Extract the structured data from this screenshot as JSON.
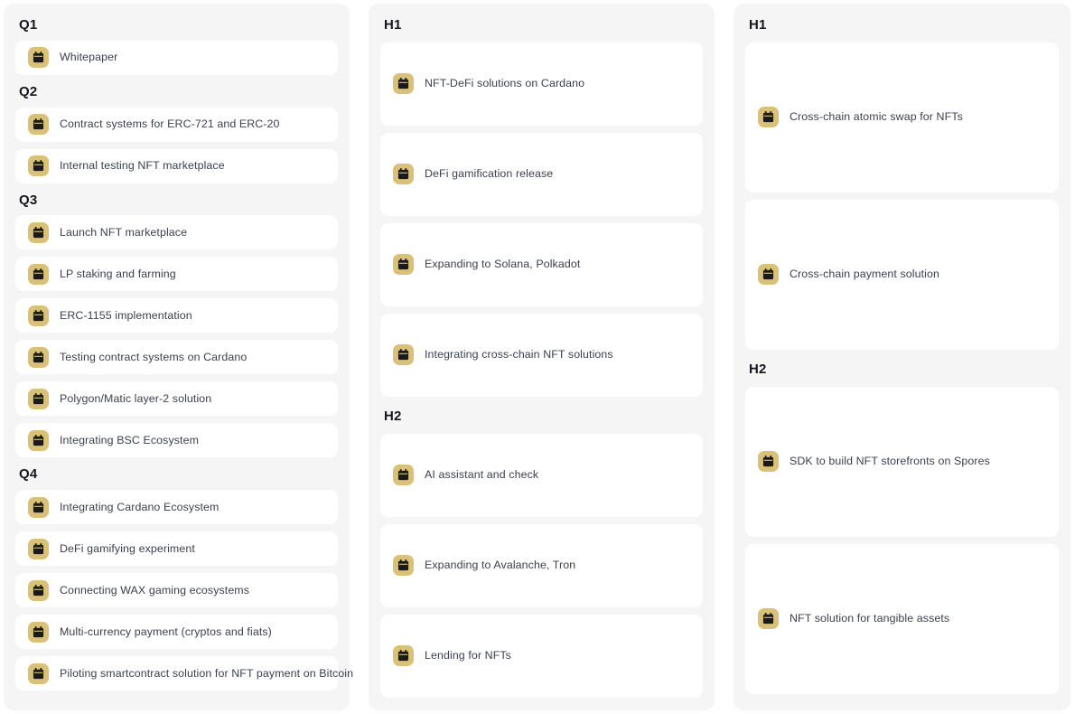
{
  "theme": {
    "page_background": "#ffffff",
    "panel_background": "#f5f5f5",
    "card_background": "#ffffff",
    "icon_badge_color": "#d9c179",
    "icon_glyph_color": "#1a1a1a",
    "heading_color": "#16161f",
    "label_color": "#3c4050"
  },
  "icons": {
    "calendar": "calendar-icon"
  },
  "columns": [
    {
      "id": "column-quarters",
      "sections": [
        {
          "heading": "Q1",
          "items": [
            {
              "label": "Whitepaper",
              "icon": "calendar-icon"
            }
          ]
        },
        {
          "heading": "Q2",
          "items": [
            {
              "label": "Contract systems for ERC-721 and ERC-20",
              "icon": "calendar-icon"
            },
            {
              "label": "Internal testing NFT marketplace",
              "icon": "calendar-icon"
            }
          ]
        },
        {
          "heading": "Q3",
          "items": [
            {
              "label": "Launch NFT marketplace",
              "icon": "calendar-icon"
            },
            {
              "label": "LP staking and farming",
              "icon": "calendar-icon"
            },
            {
              "label": "ERC-1155 implementation",
              "icon": "calendar-icon"
            },
            {
              "label": "Testing contract systems on Cardano",
              "icon": "calendar-icon"
            },
            {
              "label": "Polygon/Matic layer-2 solution",
              "icon": "calendar-icon"
            },
            {
              "label": "Integrating BSC Ecosystem",
              "icon": "calendar-icon"
            }
          ]
        },
        {
          "heading": "Q4",
          "items": [
            {
              "label": "Integrating Cardano Ecosystem",
              "icon": "calendar-icon"
            },
            {
              "label": "DeFi gamifying experiment",
              "icon": "calendar-icon"
            },
            {
              "label": "Connecting WAX gaming ecosystems",
              "icon": "calendar-icon"
            },
            {
              "label": "Multi-currency payment (cryptos and fiats)",
              "icon": "calendar-icon"
            },
            {
              "label": "Piloting smartcontract solution for NFT payment on Bitcoin",
              "icon": "calendar-icon"
            }
          ]
        }
      ]
    },
    {
      "id": "column-halves-first",
      "sections": [
        {
          "heading": "H1",
          "items": [
            {
              "label": "NFT-DeFi solutions on Cardano",
              "icon": "calendar-icon"
            },
            {
              "label": "DeFi gamification release",
              "icon": "calendar-icon"
            },
            {
              "label": "Expanding to Solana, Polkadot",
              "icon": "calendar-icon"
            },
            {
              "label": "Integrating cross-chain NFT solutions",
              "icon": "calendar-icon"
            }
          ]
        },
        {
          "heading": "H2",
          "items": [
            {
              "label": "AI assistant and check",
              "icon": "calendar-icon"
            },
            {
              "label": "Expanding to Avalanche, Tron",
              "icon": "calendar-icon"
            },
            {
              "label": "Lending for NFTs",
              "icon": "calendar-icon"
            }
          ]
        }
      ]
    },
    {
      "id": "column-halves-second",
      "sections": [
        {
          "heading": "H1",
          "items": [
            {
              "label": "Cross-chain atomic swap for NFTs",
              "icon": "calendar-icon"
            },
            {
              "label": "Cross-chain payment solution",
              "icon": "calendar-icon"
            }
          ]
        },
        {
          "heading": "H2",
          "items": [
            {
              "label": "SDK to build NFT storefronts on Spores",
              "icon": "calendar-icon"
            },
            {
              "label": "NFT solution for tangible assets",
              "icon": "calendar-icon"
            }
          ]
        }
      ]
    }
  ]
}
